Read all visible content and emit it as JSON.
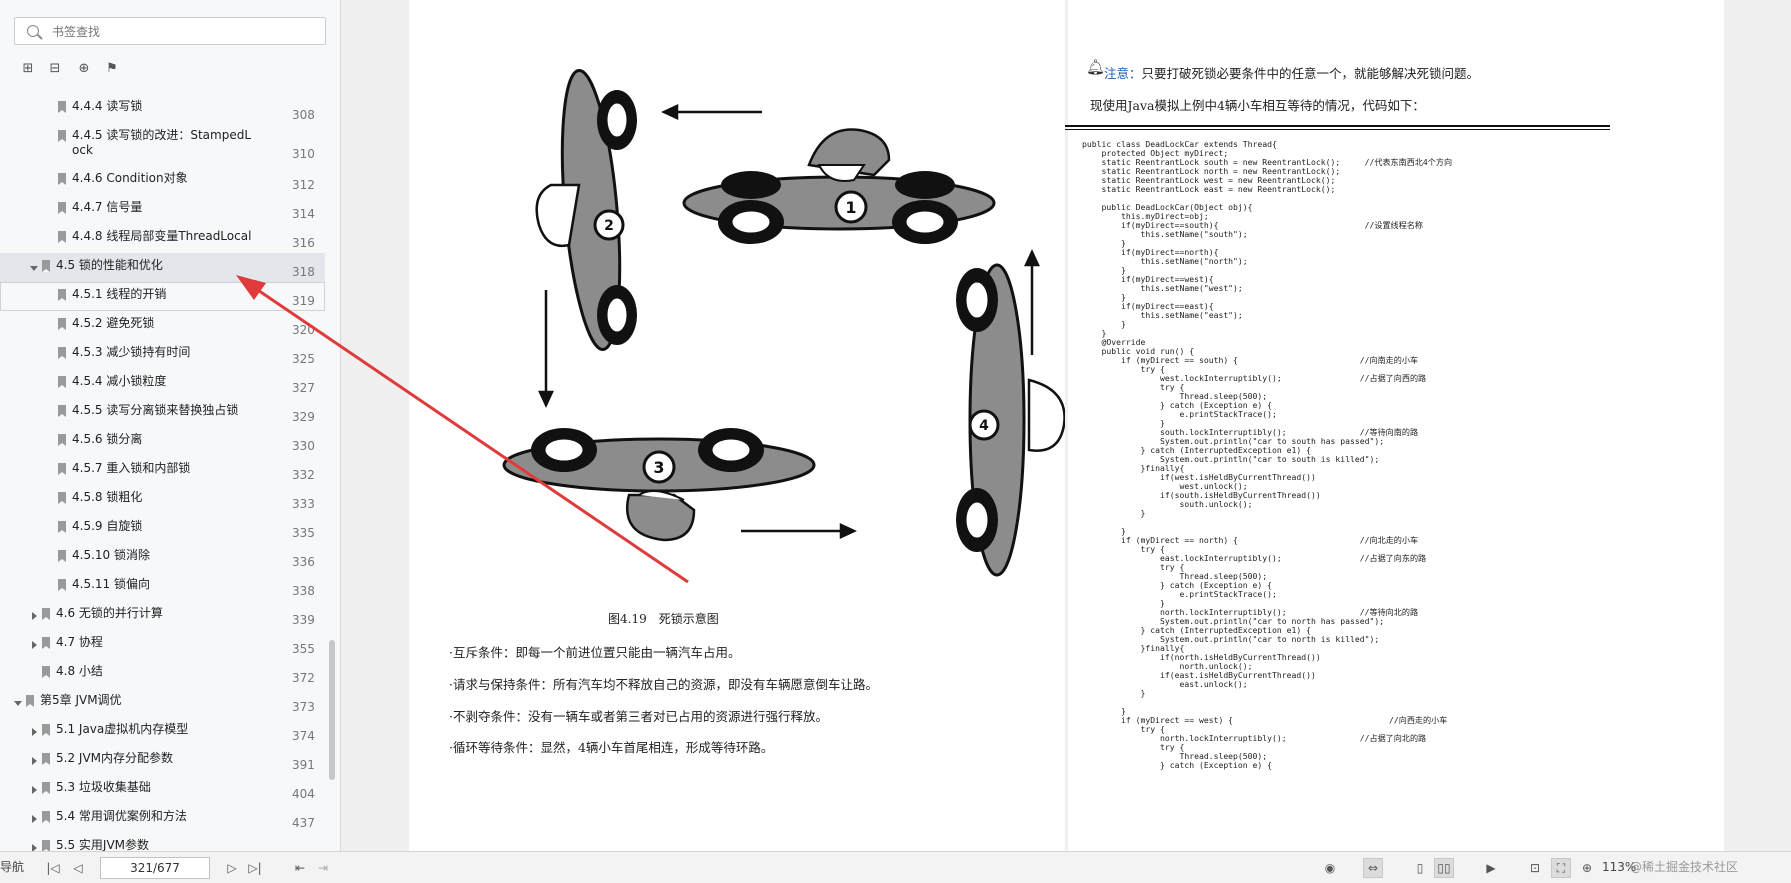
{
  "sidebar": {
    "search_placeholder": "书签查找",
    "tools": [
      "expand-all-icon",
      "collapse-all-icon",
      "add-bookmark-icon",
      "bookmark-icon"
    ],
    "items": [
      {
        "label": "4.4.4 读写锁",
        "page": "308"
      },
      {
        "label": "4.4.5 读写锁的改进：StampedLock",
        "page": "310"
      },
      {
        "label": "4.4.6 Condition对象",
        "page": "312"
      },
      {
        "label": "4.4.7 信号量",
        "page": "314"
      },
      {
        "label": "4.4.8 线程局部变量ThreadLocal",
        "page": "316"
      },
      {
        "label": "4.5 锁的性能和优化",
        "page": "318"
      },
      {
        "label": "4.5.1 线程的开销",
        "page": "319"
      },
      {
        "label": "4.5.2 避免死锁",
        "page": "320"
      },
      {
        "label": "4.5.3 减少锁持有时间",
        "page": "325"
      },
      {
        "label": "4.5.4 减小锁粒度",
        "page": "327"
      },
      {
        "label": "4.5.5 读写分离锁来替换独占锁",
        "page": "329"
      },
      {
        "label": "4.5.6 锁分离",
        "page": "330"
      },
      {
        "label": "4.5.7 重入锁和内部锁",
        "page": "332"
      },
      {
        "label": "4.5.8 锁粗化",
        "page": "333"
      },
      {
        "label": "4.5.9 自旋锁",
        "page": "335"
      },
      {
        "label": "4.5.10 锁消除",
        "page": "336"
      },
      {
        "label": "4.5.11 锁偏向",
        "page": "338"
      },
      {
        "label": "4.6 无锁的并行计算",
        "page": "339"
      },
      {
        "label": "4.7 协程",
        "page": "355"
      },
      {
        "label": "4.8 小结",
        "page": "372"
      },
      {
        "label": "第5章 JVM调优",
        "page": "373"
      },
      {
        "label": "5.1 Java虚拟机内存模型",
        "page": "374"
      },
      {
        "label": "5.2 JVM内存分配参数",
        "page": "391"
      },
      {
        "label": "5.3 垃圾收集基础",
        "page": "404"
      },
      {
        "label": "5.4 常用调优案例和方法",
        "page": "437"
      },
      {
        "label": "5.5 实用JVM参数",
        "page": ""
      }
    ]
  },
  "left_page": {
    "figure_caption": "图4.19　死锁示意图",
    "car_labels": [
      "1",
      "2",
      "3",
      "4"
    ],
    "conditions": [
      "·互斥条件：即每一个前进位置只能由一辆汽车占用。",
      "·请求与保持条件：所有汽车均不释放自己的资源，即没有车辆愿意倒车让路。",
      "·不剥夺条件：没有一辆车或者第三者对已占用的资源进行强行释放。",
      "·循环等待条件：显然，4辆小车首尾相连，形成等待环路。"
    ]
  },
  "right_page": {
    "note_label": "注意：",
    "note_text": "只要打破死锁必要条件中的任意一个，就能够解决死锁问题。",
    "intro": "现使用Java模拟上例中4辆小车相互等待的情况，代码如下：",
    "code": "public class DeadLockCar extends Thread{\n    protected Object myDirect;\n    static ReentrantLock south = new ReentrantLock();     //代表东南西北4个方向\n    static ReentrantLock north = new ReentrantLock();\n    static ReentrantLock west = new ReentrantLock();\n    static ReentrantLock east = new ReentrantLock();\n\n    public DeadLockCar(Object obj){\n        this.myDirect=obj;\n        if(myDirect==south){                              //设置线程名称\n            this.setName(\"south\");\n        }\n        if(myDirect==north){\n            this.setName(\"north\");\n        }\n        if(myDirect==west){\n            this.setName(\"west\");\n        }\n        if(myDirect==east){\n            this.setName(\"east\");\n        }\n    }\n    @Override\n    public void run() {\n        if (myDirect == south) {                         //向南走的小车\n            try {\n                west.lockInterruptibly();                //占据了向西的路\n                try {\n                    Thread.sleep(500);\n                } catch (Exception e) {\n                    e.printStackTrace();\n                }\n                south.lockInterruptibly();               //等待向南的路\n                System.out.println(\"car to south has passed\");\n            } catch (InterruptedException e1) {\n                System.out.println(\"car to south is killed\");\n            }finally{\n                if(west.isHeldByCurrentThread())\n                    west.unlock();\n                if(south.isHeldByCurrentThread())\n                    south.unlock();\n            }\n\n        }\n        if (myDirect == north) {                         //向北走的小车\n            try {\n                east.lockInterruptibly();                //占据了向东的路\n                try {\n                    Thread.sleep(500);\n                } catch (Exception e) {\n                    e.printStackTrace();\n                }\n                north.lockInterruptibly();               //等待向北的路\n                System.out.println(\"car to north has passed\");\n            } catch (InterruptedException e1) {\n                System.out.println(\"car to north is killed\");\n            }finally{\n                if(north.isHeldByCurrentThread())\n                    north.unlock();\n                if(east.isHeldByCurrentThread())\n                    east.unlock();\n            }\n\n        }\n        if (myDirect == west) {                                //向西走的小车\n            try {\n                north.lockInterruptibly();               //占据了向北的路\n                try {\n                    Thread.sleep(500);\n                } catch (Exception e) {"
  },
  "statusbar": {
    "left_label": "导航",
    "page_value": "321/677",
    "zoom": "113%",
    "watermark": "@稀土掘金技术社区"
  },
  "colors": {
    "sidebar_bg": "#f7f8fa",
    "selected_row": "#e3e6ea",
    "arrow": "#e03a3a",
    "note_blue": "#2060c0"
  }
}
